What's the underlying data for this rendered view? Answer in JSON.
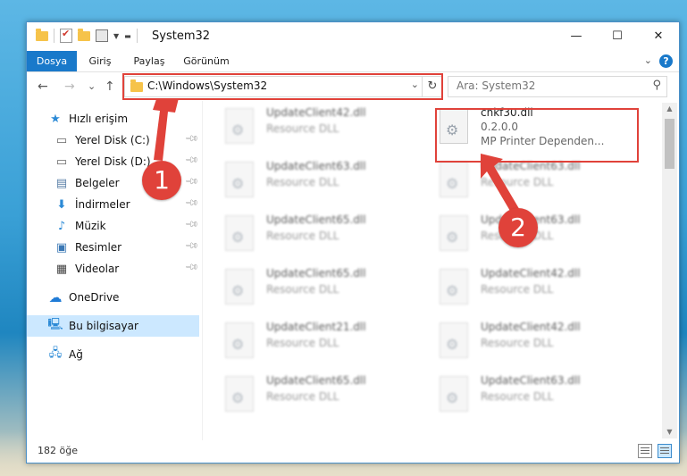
{
  "window": {
    "title": "System32",
    "minimize": "—",
    "maximize": "☐",
    "close": "✕"
  },
  "ribbon": {
    "tabs": [
      "Dosya",
      "Giriş",
      "Paylaş",
      "Görünüm"
    ],
    "help": "?"
  },
  "nav": {
    "back": "←",
    "forward": "→",
    "recent": "⌄",
    "up": "↑",
    "address": "C:\\Windows\\System32",
    "search_placeholder": "Ara: System32"
  },
  "sidebar": {
    "items": [
      {
        "label": "Hızlı erişim",
        "icon": "star-icon"
      },
      {
        "label": "Yerel Disk (C:)",
        "icon": "drive-icon",
        "pinned": true
      },
      {
        "label": "Yerel Disk (D:)",
        "icon": "drive-icon",
        "pinned": true
      },
      {
        "label": "Belgeler",
        "icon": "document-icon",
        "pinned": true
      },
      {
        "label": "İndirmeler",
        "icon": "download-icon",
        "pinned": true
      },
      {
        "label": "Müzik",
        "icon": "music-icon",
        "pinned": true
      },
      {
        "label": "Resimler",
        "icon": "pictures-icon",
        "pinned": true
      },
      {
        "label": "Videolar",
        "icon": "videos-icon",
        "pinned": true
      },
      {
        "label": "OneDrive",
        "icon": "cloud-icon"
      },
      {
        "label": "Bu bilgisayar",
        "icon": "computer-icon",
        "selected": true
      },
      {
        "label": "Ağ",
        "icon": "network-icon"
      }
    ]
  },
  "files": {
    "highlighted": {
      "name": "cnkf30.dll",
      "version": "0.2.0.0",
      "description": "MP Printer Dependen..."
    },
    "left_column": [
      {
        "name": "UpdateClient42.dll",
        "desc": "Resource DLL"
      },
      {
        "name": "UpdateClient63.dll",
        "desc": "Resource DLL"
      },
      {
        "name": "UpdateClient65.dll",
        "desc": "Resource DLL"
      },
      {
        "name": "UpdateClient65.dll",
        "desc": "Resource DLL"
      },
      {
        "name": "UpdateClient21.dll",
        "desc": "Resource DLL"
      },
      {
        "name": "UpdateClient65.dll",
        "desc": "Resource DLL"
      }
    ],
    "right_column": [
      {
        "name": "UpdateClient63.dll",
        "desc": "Resource DLL"
      },
      {
        "name": "UpdateClient63.dll",
        "desc": "Resource DLL"
      },
      {
        "name": "UpdateClient42.dll",
        "desc": "Resource DLL"
      },
      {
        "name": "UpdateClient42.dll",
        "desc": "Resource DLL"
      },
      {
        "name": "UpdateClient63.dll",
        "desc": "Resource DLL"
      }
    ]
  },
  "status": {
    "count": "182 öğe"
  },
  "annotations": {
    "badge1": "1",
    "badge2": "2",
    "color": "#e0423a"
  }
}
